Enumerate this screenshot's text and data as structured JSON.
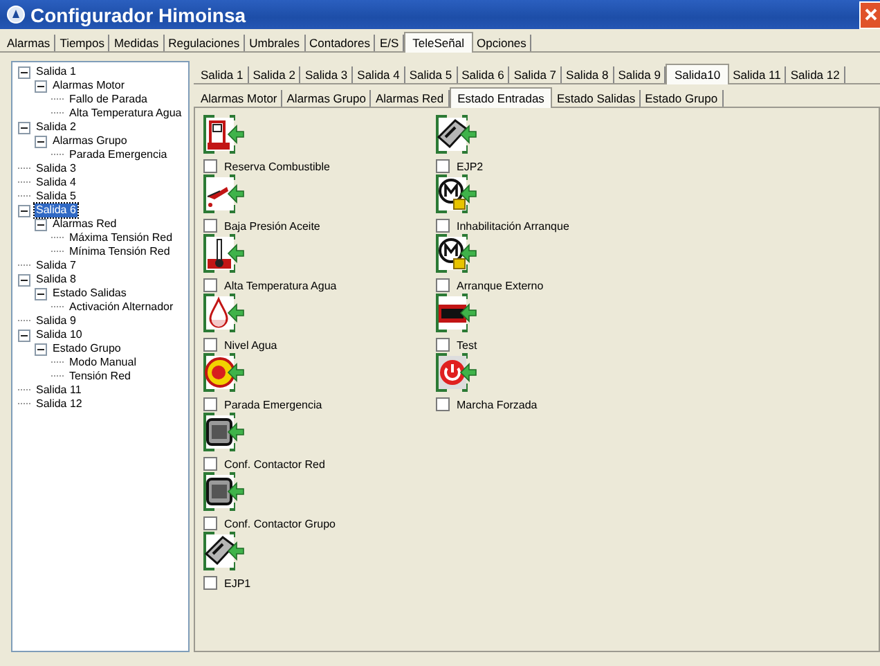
{
  "window": {
    "title": "Configurador Himoinsa"
  },
  "tabs": [
    {
      "label": "Alarmas",
      "selected": false
    },
    {
      "label": "Tiempos",
      "selected": false
    },
    {
      "label": "Medidas",
      "selected": false
    },
    {
      "label": "Regulaciones",
      "selected": false
    },
    {
      "label": "Umbrales",
      "selected": false
    },
    {
      "label": "Contadores",
      "selected": false
    },
    {
      "label": "E/S",
      "selected": false
    },
    {
      "label": "TeleSeñal",
      "selected": true
    },
    {
      "label": "Opciones",
      "selected": false
    }
  ],
  "tree": [
    {
      "label": "Salida 1",
      "expanded": true,
      "selected": false,
      "children": [
        {
          "label": "Alarmas Motor",
          "expanded": true,
          "selected": false,
          "children": [
            {
              "label": "Fallo de Parada",
              "selected": false
            },
            {
              "label": "Alta Temperatura  Agua",
              "selected": false
            }
          ]
        }
      ]
    },
    {
      "label": "Salida 2",
      "expanded": true,
      "selected": false,
      "children": [
        {
          "label": "Alarmas Grupo",
          "expanded": true,
          "selected": false,
          "children": [
            {
              "label": "Parada Emergencia",
              "selected": false
            }
          ]
        }
      ]
    },
    {
      "label": "Salida 3",
      "selected": false
    },
    {
      "label": "Salida 4",
      "selected": false
    },
    {
      "label": "Salida 5",
      "selected": false
    },
    {
      "label": "Salida 6",
      "expanded": true,
      "selected": true,
      "children": [
        {
          "label": "Alarmas Red",
          "expanded": true,
          "selected": false,
          "children": [
            {
              "label": "Máxima Tensión Red",
              "selected": false
            },
            {
              "label": "Mínima Tensión Red",
              "selected": false
            }
          ]
        }
      ]
    },
    {
      "label": "Salida 7",
      "selected": false
    },
    {
      "label": "Salida 8",
      "expanded": true,
      "selected": false,
      "children": [
        {
          "label": "Estado Salidas",
          "expanded": true,
          "selected": false,
          "children": [
            {
              "label": "Activación Alternador",
              "selected": false
            }
          ]
        }
      ]
    },
    {
      "label": "Salida 9",
      "selected": false
    },
    {
      "label": "Salida 10",
      "expanded": true,
      "selected": false,
      "children": [
        {
          "label": "Estado Grupo",
          "expanded": true,
          "selected": false,
          "children": [
            {
              "label": "Modo Manual",
              "selected": false
            },
            {
              "label": "Tensión Red",
              "selected": false
            }
          ]
        }
      ]
    },
    {
      "label": "Salida 11",
      "selected": false
    },
    {
      "label": "Salida 12",
      "selected": false
    }
  ],
  "output_tabs": [
    {
      "label": "Salida 1",
      "selected": false
    },
    {
      "label": "Salida 2",
      "selected": false
    },
    {
      "label": "Salida 3",
      "selected": false
    },
    {
      "label": "Salida 4",
      "selected": false
    },
    {
      "label": "Salida 5",
      "selected": false
    },
    {
      "label": "Salida 6",
      "selected": false
    },
    {
      "label": "Salida 7",
      "selected": false
    },
    {
      "label": "Salida 8",
      "selected": false
    },
    {
      "label": "Salida 9",
      "selected": false
    },
    {
      "label": "Salida10",
      "selected": true
    },
    {
      "label": "Salida 11",
      "selected": false
    },
    {
      "label": "Salida 12",
      "selected": false
    }
  ],
  "group_tabs": [
    {
      "label": "Alarmas Motor",
      "selected": false
    },
    {
      "label": "Alarmas Grupo",
      "selected": false
    },
    {
      "label": "Alarmas Red",
      "selected": false
    },
    {
      "label": "Estado Entradas",
      "selected": true
    },
    {
      "label": "Estado Salidas",
      "selected": false
    },
    {
      "label": "Estado Grupo",
      "selected": false
    }
  ],
  "columns": [
    {
      "items": [
        {
          "label": "Reserva Combustible",
          "checked": false
        },
        {
          "label": "Baja Presión Aceite",
          "checked": false
        },
        {
          "label": "Alta Temperatura Agua",
          "checked": false
        },
        {
          "label": "Nivel Agua",
          "checked": false
        },
        {
          "label": "Parada Emergencia",
          "checked": false
        },
        {
          "label": "Conf. Contactor Red",
          "checked": false
        },
        {
          "label": "Conf. Contactor Grupo",
          "checked": false
        },
        {
          "label": "EJP1",
          "checked": false
        }
      ]
    },
    {
      "items": [
        {
          "label": "EJP2",
          "checked": false
        },
        {
          "label": "Inhabilitación Arranque",
          "checked": false
        },
        {
          "label": "Arranque Externo",
          "checked": false
        },
        {
          "label": "Test",
          "checked": false
        },
        {
          "label": "Marcha Forzada",
          "checked": false
        }
      ]
    }
  ]
}
